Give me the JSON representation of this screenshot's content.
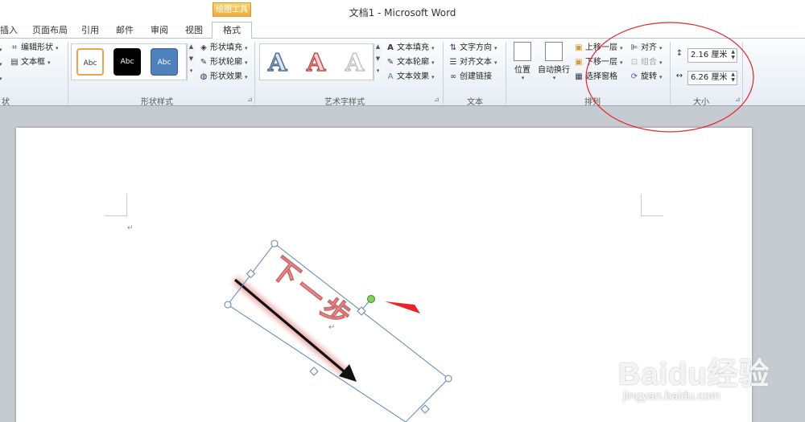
{
  "window": {
    "title": "文档1 - Microsoft Word"
  },
  "tabs": {
    "insert": "插入",
    "page_layout": "页面布局",
    "references": "引用",
    "mailings": "邮件",
    "review": "审阅",
    "view": "视图",
    "contextual_group": "绘图工具",
    "format": "格式"
  },
  "ribbon": {
    "insert_shapes": {
      "edit_shape": "编辑形状",
      "text_box": "文本框",
      "label_fragment": "状"
    },
    "shape_styles": {
      "gallery": [
        "Abc",
        "Abc",
        "Abc"
      ],
      "shape_fill": "形状填充",
      "shape_outline": "形状轮廓",
      "shape_effects": "形状效果",
      "label": "形状样式"
    },
    "wordart_styles": {
      "gallery": [
        "A",
        "A",
        "A"
      ],
      "text_fill": "文本填充",
      "text_outline": "文本轮廓",
      "text_effects": "文本效果",
      "label": "艺术字样式"
    },
    "text": {
      "text_direction": "文字方向",
      "align_text": "对齐文本",
      "create_link": "创建链接",
      "label": "文本"
    },
    "arrange": {
      "position": "位置",
      "wrap_text": "自动换行",
      "bring_forward": "上移一层",
      "send_backward": "下移一层",
      "selection_pane": "选择窗格",
      "align": "对齐",
      "group": "组合",
      "rotate": "旋转",
      "label": "排列"
    },
    "size": {
      "height": "2.16 厘米",
      "width": "6.26 厘米",
      "label": "大小"
    }
  },
  "document": {
    "paragraph_mark": "↵",
    "textbox_text": "下一步",
    "textbox_mark": "↵"
  },
  "colors": {
    "accent_gold": "#eaa83a",
    "annotation_red": "#e8232a",
    "wordart_pink": "#e48a8a",
    "selection_blue": "#5b86b6",
    "rotation_handle": "#7dd35a"
  },
  "watermark": {
    "logo": "Baidu经验",
    "url": "jingyan.baidu.com"
  }
}
